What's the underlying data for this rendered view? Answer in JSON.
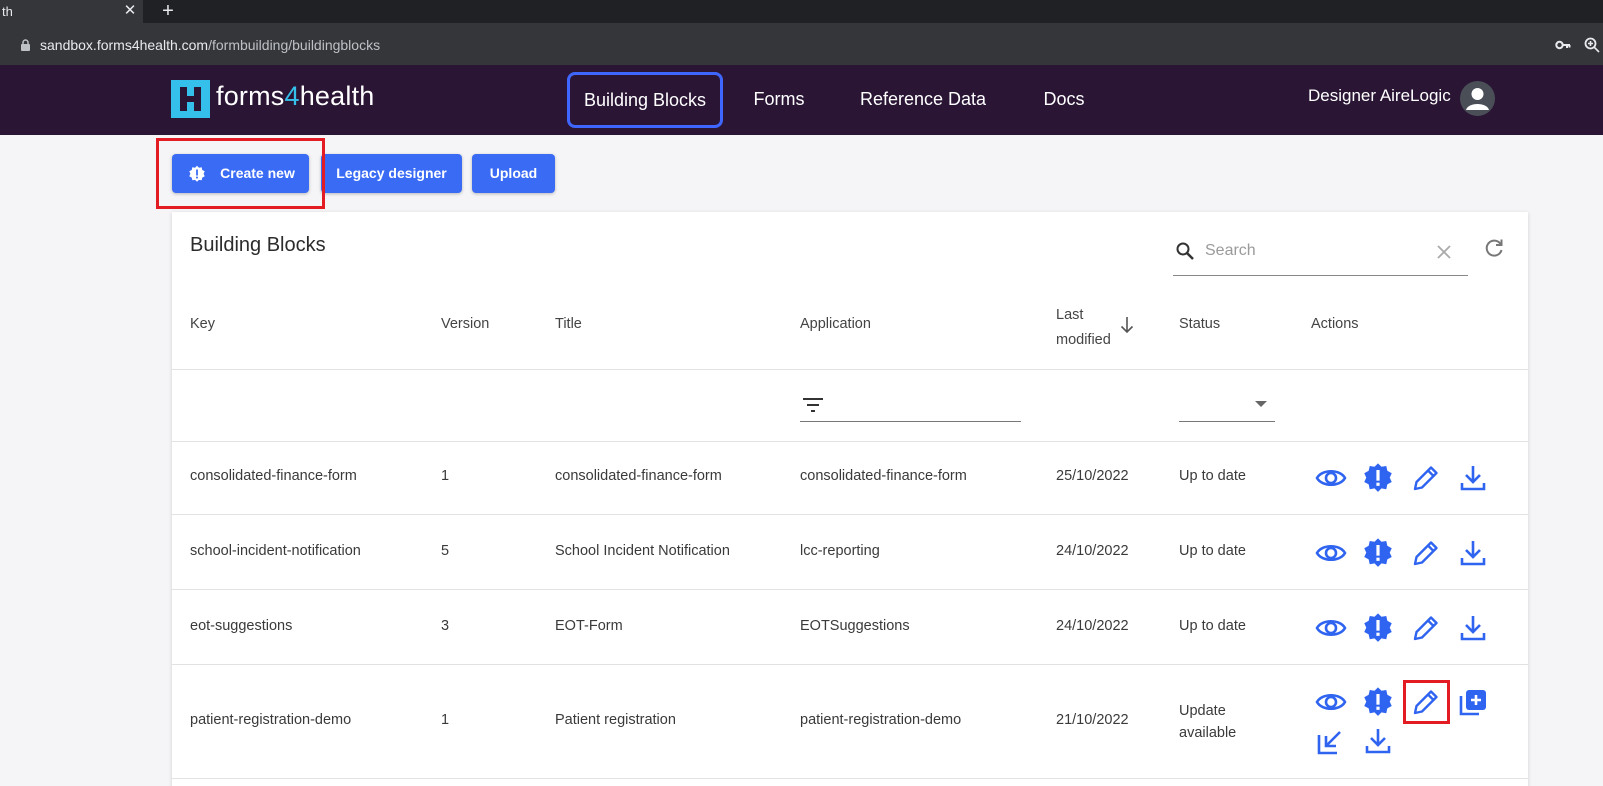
{
  "browser": {
    "tab_title": "th",
    "tab_close": "✕",
    "new_tab": "+",
    "url_host": "sandbox.forms4health.com",
    "url_path": "/formbuilding/buildingblocks"
  },
  "header": {
    "logo_prefix": "forms",
    "logo_digit": "4",
    "logo_suffix": "health",
    "nav": [
      "Building Blocks",
      "Forms",
      "Reference Data",
      "Docs"
    ],
    "active_nav": "Building Blocks",
    "user_name": "Designer AireLogic"
  },
  "toolbar": {
    "create_new": "Create new",
    "legacy_designer": "Legacy designer",
    "upload": "Upload"
  },
  "card": {
    "title": "Building Blocks",
    "search_placeholder": "Search"
  },
  "table": {
    "columns": {
      "key": "Key",
      "version": "Version",
      "title": "Title",
      "application": "Application",
      "last_modified_1": "Last",
      "last_modified_2": "modified",
      "status": "Status",
      "actions": "Actions"
    },
    "rows": [
      {
        "key": "consolidated-finance-form",
        "version": "1",
        "title": "consolidated-finance-form",
        "application": "consolidated-finance-form",
        "modified": "25/10/2022",
        "status": "Up to date"
      },
      {
        "key": "school-incident-notification",
        "version": "5",
        "title": "School Incident Notification",
        "application": "lcc-reporting",
        "modified": "24/10/2022",
        "status": "Up to date"
      },
      {
        "key": "eot-suggestions",
        "version": "3",
        "title": "EOT-Form",
        "application": "EOTSuggestions",
        "modified": "24/10/2022",
        "status": "Up to date"
      },
      {
        "key": "patient-registration-demo",
        "version": "1",
        "title": "Patient registration",
        "application": "patient-registration-demo",
        "modified": "21/10/2022",
        "status_line1": "Update",
        "status_line2": "available"
      }
    ]
  },
  "colors": {
    "accent": "#3a6bf5",
    "header_bg": "#2a1535",
    "highlight": "#e31b23",
    "icon_blue": "#2f64f0"
  }
}
